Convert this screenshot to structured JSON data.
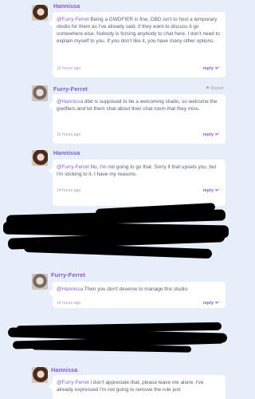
{
  "comments": [
    {
      "author": "Hannissa",
      "mention": "@Furry-Ferret",
      "text": " Being a GWDFIER is fine, DBD isn't to host a temporary studio for them as I've already said, if they want to discuss it go somewhere else. Nobody is forcing anybody to chat here. I don't need to explain myself to you. If you don't like it, you have many other options.",
      "time": "15 hours ago",
      "reply": "reply"
    },
    {
      "author": "Furry-Ferret",
      "report": "Report",
      "mention": "@Hannissa",
      "text": " dbd is supposed to be a welcoming studio, so welcome the gwdfiers and let them chat about their chat room that they miss.",
      "time": "15 hours ago",
      "reply": "reply"
    },
    {
      "author": "Hannissa",
      "mention": "@Furry-Ferret",
      "text": " No, I'm not going to go that. Sorry if that upsets you, but I'm sticking to it. I have my reasons.",
      "time": "14 hours ago",
      "reply": "reply"
    },
    {
      "author": "Furry-Ferret",
      "mention": "@Hannissa",
      "text": " Then you don't deserve to manage this studio.",
      "time": "14 hours ago",
      "reply": "reply"
    },
    {
      "author": "Hannissa",
      "mention": "@Furry-Ferret",
      "text": " I don't appreciate that, please leave me alone. I've already expressed I'm not going to remove the rule just"
    }
  ],
  "icons": {
    "reply": "reply-arrow-icon",
    "report": "report-flag-icon"
  }
}
